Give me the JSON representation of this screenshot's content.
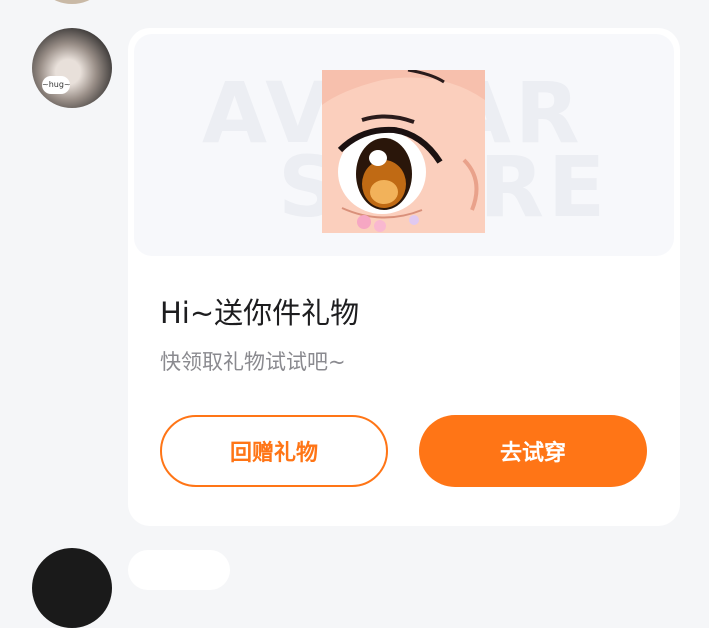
{
  "card": {
    "watermark_line1": "AVATAR",
    "watermark_line2": "STORE",
    "title": "Hi~送你件礼物",
    "subtitle": "快领取礼物试试吧~",
    "gift_back_button": "回赠礼物",
    "try_on_button": "去试穿"
  },
  "avatar_bubble": "~hug~",
  "colors": {
    "accent": "#ff7516",
    "background": "#f5f6f8",
    "card": "#ffffff"
  }
}
